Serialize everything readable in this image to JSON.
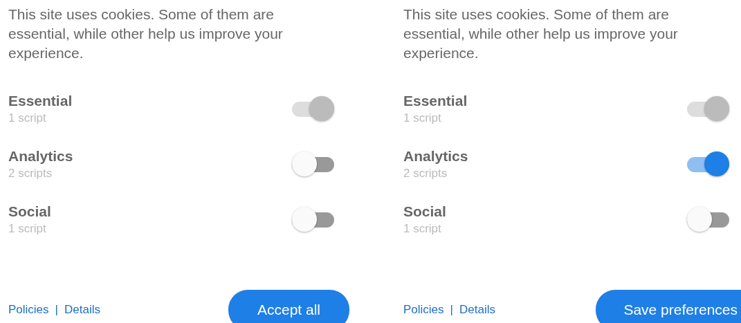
{
  "panels": [
    {
      "description": "This site uses cookies. Some of them are essential, while other help us improve your experience.",
      "categories": [
        {
          "name": "Essential",
          "count": "1 script",
          "on": true,
          "disabled": true
        },
        {
          "name": "Analytics",
          "count": "2 scripts",
          "on": false,
          "disabled": false
        },
        {
          "name": "Social",
          "count": "1 script",
          "on": false,
          "disabled": false
        }
      ],
      "links": [
        "Policies",
        "Details"
      ],
      "separator": "|",
      "button": "Accept all"
    },
    {
      "description": "This site uses cookies. Some of them are essential, while other help us improve your experience.",
      "categories": [
        {
          "name": "Essential",
          "count": "1 script",
          "on": true,
          "disabled": true
        },
        {
          "name": "Analytics",
          "count": "2 scripts",
          "on": true,
          "disabled": false
        },
        {
          "name": "Social",
          "count": "1 script",
          "on": false,
          "disabled": false
        }
      ],
      "links": [
        "Policies",
        "Details"
      ],
      "separator": "|",
      "button": "Save preferences"
    }
  ]
}
